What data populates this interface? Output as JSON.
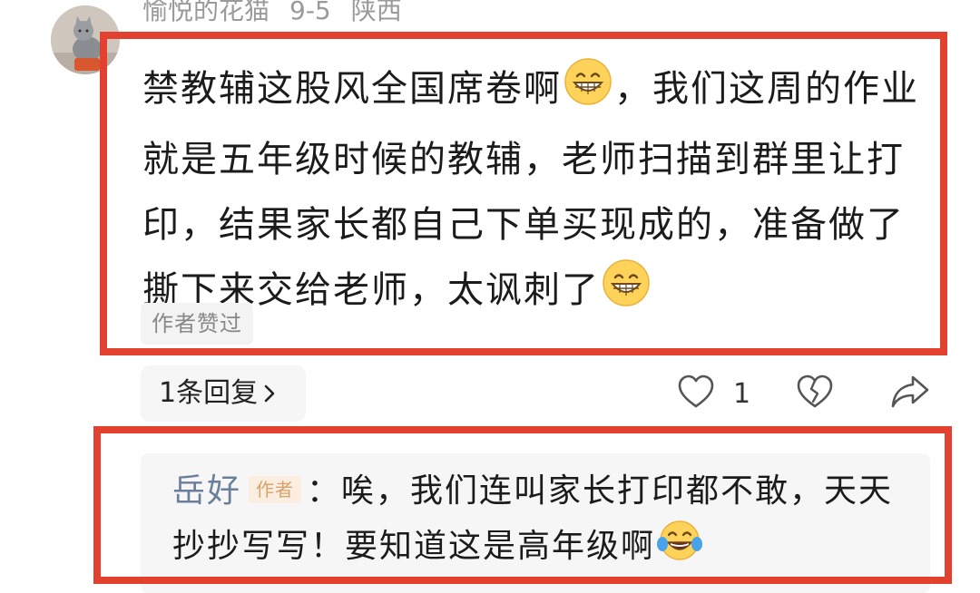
{
  "comment": {
    "author": "愉悦的花猫",
    "date": "9-5",
    "region": "陕西",
    "text_1": "禁教辅这股风全国席卷啊",
    "text_2": "，我们这周的作业就是五年级时候的教辅，老师扫描到群里让打印，结果家长都自己下单买现成的，准备做了撕下来交给老师，太讽刺了",
    "emoji_1": "grinning-face-emoji",
    "emoji_2": "grinning-face-emoji",
    "badge": "作者赞过"
  },
  "actions": {
    "reply_count_label": "1条回复",
    "like_count": "1",
    "like_icon": "heart-outline-icon",
    "dislike_icon": "broken-heart-icon",
    "share_icon": "share-arrow-icon"
  },
  "reply": {
    "name": "岳好",
    "author_tag": "作者",
    "text": "：唉，我们连叫家长打印都不敢，天天抄抄写写！要知道这是高年级啊",
    "emoji": "tears-of-joy-emoji"
  },
  "colors": {
    "highlight": "#e2412f",
    "meta_gray": "#9a9a9a",
    "reply_name": "#6b7e9a",
    "author_tag_bg": "#fbeee0",
    "author_tag_fg": "#d8a36b"
  }
}
